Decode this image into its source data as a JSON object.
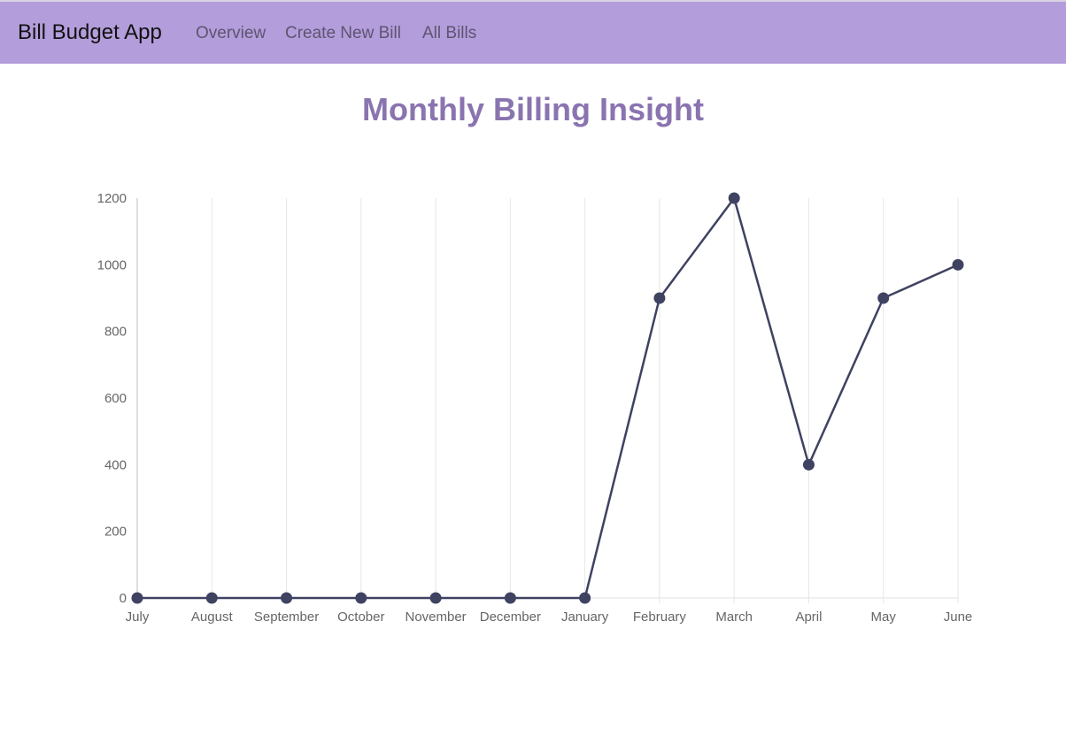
{
  "navbar": {
    "brand": "Bill Budget App",
    "links": [
      "Overview",
      "Create New Bill",
      "All Bills"
    ]
  },
  "page": {
    "title": "Monthly Billing Insight"
  },
  "colors": {
    "navbar_bg": "#b39ddb",
    "title": "#8a74b0",
    "line": "#3f4261",
    "grid": "#e6e6e6"
  },
  "chart_data": {
    "type": "line",
    "categories": [
      "July",
      "August",
      "September",
      "October",
      "November",
      "December",
      "January",
      "February",
      "March",
      "April",
      "May",
      "June"
    ],
    "series": [
      {
        "values": [
          0,
          0,
          0,
          0,
          0,
          0,
          0,
          900,
          1200,
          400,
          900,
          1000
        ]
      }
    ],
    "yticks": [
      "0",
      "200",
      "400",
      "600",
      "800",
      "1000",
      "1200"
    ],
    "ylim": [
      0,
      1200
    ],
    "grid": "vertical",
    "legend": "none",
    "title": "",
    "xlabel": "",
    "ylabel": ""
  }
}
